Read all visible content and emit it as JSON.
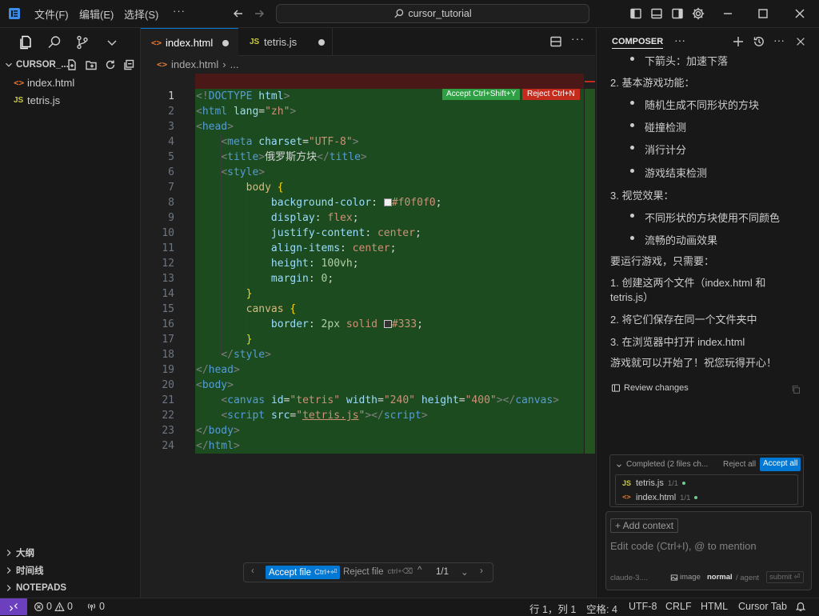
{
  "titlebar": {
    "menus": [
      "文件(F)",
      "编辑(E)",
      "选择(S)",
      "···"
    ],
    "search_text": "cursor_tutorial"
  },
  "sidebar": {
    "folder": "CURSOR_...",
    "files": [
      {
        "name": "index.html",
        "type": "html"
      },
      {
        "name": "tetris.js",
        "type": "js"
      }
    ],
    "sections": [
      "大纲",
      "时间线",
      "NOTEPADS"
    ]
  },
  "editor": {
    "tabs": [
      {
        "label": "index.html",
        "type": "html",
        "active": true
      },
      {
        "label": "tetris.js",
        "type": "js",
        "active": false
      }
    ],
    "breadcrumb": [
      "index.html",
      "..."
    ],
    "accept_label": "Accept Ctrl+Shift+Y",
    "reject_label": "Reject Ctrl+N",
    "line_numbers": [
      "1",
      "2",
      "3",
      "4",
      "5",
      "6",
      "7",
      "8",
      "9",
      "10",
      "11",
      "12",
      "13",
      "14",
      "15",
      "16",
      "17",
      "18",
      "19",
      "20",
      "21",
      "22",
      "23",
      "24"
    ],
    "swatch_1": "#f0f0f0",
    "swatch_2": "#333",
    "toolbar": {
      "accept_file": "Accept file",
      "accept_shortcut": "Ctrl+⏎",
      "reject_file": "Reject file",
      "reject_shortcut": "ctrl+⌫",
      "counter": "1/1"
    }
  },
  "composer": {
    "title": "COMPOSER",
    "content": [
      {
        "type": "bullet",
        "text": "下箭头：加速下落"
      },
      {
        "type": "para",
        "text": "2. 基本游戏功能："
      },
      {
        "type": "bullet",
        "text": "随机生成不同形状的方块"
      },
      {
        "type": "bullet",
        "text": "碰撞检测"
      },
      {
        "type": "bullet",
        "text": "消行计分"
      },
      {
        "type": "bullet",
        "text": "游戏结束检测"
      },
      {
        "type": "para",
        "text": "3. 视觉效果："
      },
      {
        "type": "bullet",
        "text": "不同形状的方块使用不同颜色"
      },
      {
        "type": "bullet",
        "text": "流畅的动画效果"
      },
      {
        "type": "para",
        "text": "要运行游戏，只需要："
      },
      {
        "type": "para",
        "text": "1. 创建这两个文件（index.html 和"
      },
      {
        "type": "para",
        "text": "tetris.js）"
      },
      {
        "type": "para",
        "text": "2. 将它们保存在同一个文件夹中"
      },
      {
        "type": "para",
        "text": "3. 在浏览器中打开 index.html"
      },
      {
        "type": "para",
        "text": "游戏就可以开始了！祝您玩得开心！"
      }
    ],
    "review_changes": "Review changes",
    "completed_label": "Completed (2 files ch...",
    "reject_all": "Reject all",
    "accept_all": "Accept all",
    "changed_files": [
      {
        "name": "tetris.js",
        "type": "js",
        "count": "1/1"
      },
      {
        "name": "index.html",
        "type": "html",
        "count": "1/1"
      }
    ],
    "add_context": "+ Add context",
    "input_placeholder": "Edit code (Ctrl+I), @ to mention",
    "model": "claude-3....",
    "image_label": "image",
    "mode_normal": "normal",
    "mode_agent": "/ agent",
    "submit": "submit ⏎"
  },
  "statusbar": {
    "errors": "0",
    "warnings": "0",
    "ports": "0",
    "position": "行 1，列 1",
    "spaces": "空格: 4",
    "encoding": "UTF-8",
    "eol": "CRLF",
    "language": "HTML",
    "cursor_tab": "Cursor Tab"
  },
  "colors": {
    "accent": "#0078d4",
    "added_bg": "#1b4b1f",
    "removed_bg": "#4b1818",
    "accept_green": "#2ea043",
    "reject_red": "#c42b1c",
    "remote_purple": "#6b3fbd"
  }
}
